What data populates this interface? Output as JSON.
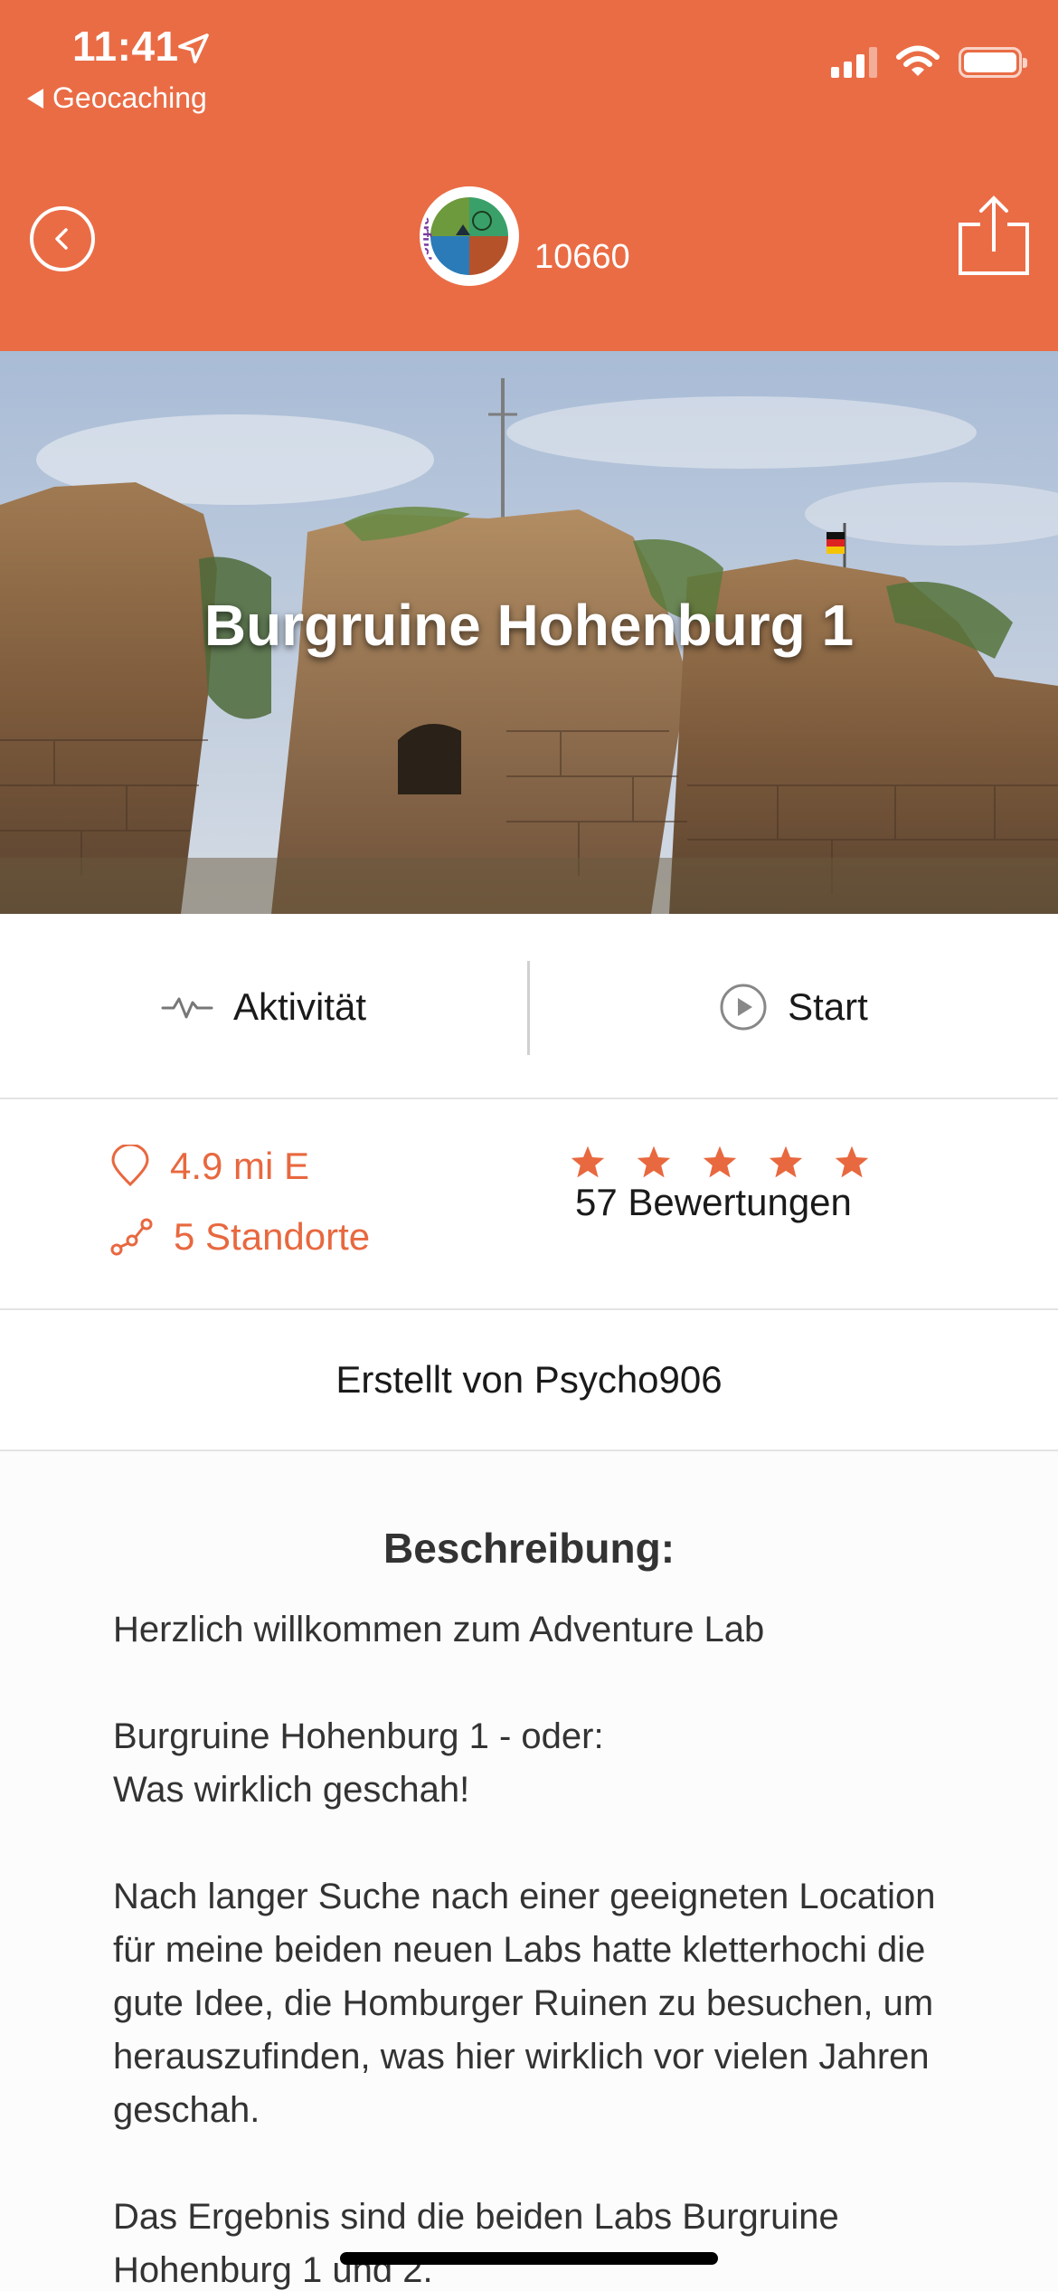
{
  "status_bar": {
    "time": "11:41",
    "back_app": "Geocaching"
  },
  "header": {
    "user_points": "10660",
    "avatar_text": "narfuchs"
  },
  "hero": {
    "title": "Burgruine Hohenburg 1"
  },
  "actions": {
    "activity_label": "Aktivität",
    "start_label": "Start"
  },
  "info": {
    "distance": "4.9 mi E",
    "locations": "5 Standorte",
    "rating_stars": 5,
    "reviews": "57 Bewertungen"
  },
  "author": {
    "label": "Erstellt von Psycho906"
  },
  "description": {
    "heading": "Beschreibung:",
    "para1": "Herzlich willkommen zum Adventure Lab",
    "para2_line1": "Burgruine Hohenburg 1 - oder:",
    "para2_line2": "Was wirklich geschah!",
    "para3": "Nach langer Suche nach einer geeigneten Location für meine beiden neuen Labs hatte kletterhochi die gute Idee, die Homburger Ruinen zu besuchen, um herauszufinden, was hier wirklich vor vielen Jahren geschah.",
    "para4": "Das Ergebnis sind die beiden Labs Burgruine Hohenburg 1 und 2."
  },
  "colors": {
    "brand_orange": "#ea6c45",
    "accent_text": "#e8683f"
  },
  "icons": {
    "location_arrow": "location-arrow-icon",
    "back": "chevron-left-circle-icon",
    "share": "share-icon",
    "activity": "activity-pulse-icon",
    "start": "play-circle-icon",
    "distance": "map-pin-icon",
    "locations": "route-icon",
    "star": "star-icon"
  }
}
